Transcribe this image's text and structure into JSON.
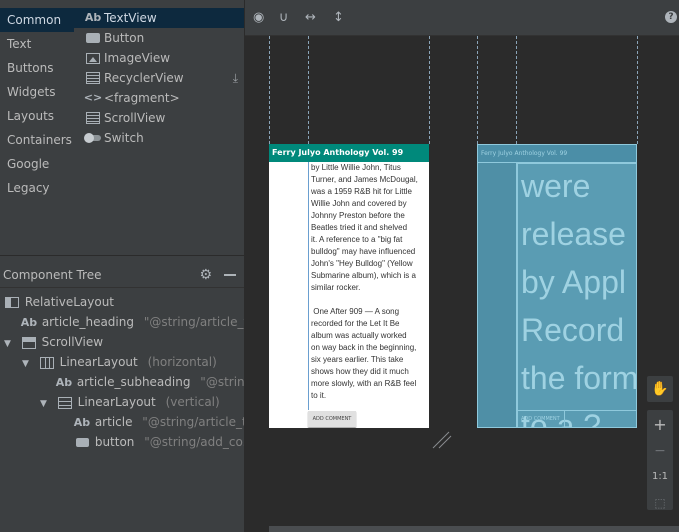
{
  "palette": {
    "categories": [
      "Common",
      "Text",
      "Buttons",
      "Widgets",
      "Layouts",
      "Containers",
      "Google",
      "Legacy"
    ],
    "selected_category": "Common",
    "items": [
      {
        "label": "TextView",
        "icon": "textview-icon",
        "glyph": "Ab"
      },
      {
        "label": "Button",
        "icon": "button-icon"
      },
      {
        "label": "ImageView",
        "icon": "imageview-icon"
      },
      {
        "label": "RecyclerView",
        "icon": "recyclerview-icon",
        "download": "⤓"
      },
      {
        "label": "<fragment>",
        "icon": "fragment-icon",
        "glyph": "<>"
      },
      {
        "label": "ScrollView",
        "icon": "scrollview-icon"
      },
      {
        "label": "Switch",
        "icon": "switch-icon"
      }
    ]
  },
  "tree": {
    "title": "Component Tree",
    "rows": [
      {
        "name": "RelativeLayout",
        "meta": "",
        "icon": "relativelayout-icon"
      },
      {
        "name": "article_heading",
        "meta": "\"@string/article_tit...",
        "icon": "textview-icon",
        "glyph": "Ab"
      },
      {
        "name": "ScrollView",
        "meta": "",
        "icon": "scrollview-icon",
        "arrow": "▼"
      },
      {
        "name": "LinearLayout",
        "meta": "(horizontal)",
        "icon": "linearlayout-horizontal-icon",
        "arrow": "▼"
      },
      {
        "name": "article_subheading",
        "meta": "\"@strin...",
        "icon": "textview-icon",
        "glyph": "Ab"
      },
      {
        "name": "LinearLayout",
        "meta": "(vertical)",
        "icon": "linearlayout-vertical-icon",
        "arrow": "▼"
      },
      {
        "name": "article",
        "meta": "\"@string/article_t...",
        "icon": "textview-icon",
        "glyph": "Ab"
      },
      {
        "name": "button",
        "meta": "\"@string/add_co...",
        "icon": "button-icon"
      }
    ]
  },
  "toolbar": {
    "eye": "◉",
    "magnet": "∪",
    "h_arrows": "↔",
    "v_arrows": "↕",
    "help": "?"
  },
  "device": {
    "heading": "Ferry Julyo Anthology Vol. 99",
    "article": "by Little Willie John, Titus\nTurner, and James McDougal,\nwas a 1959 R&B hit for Little\nWillie John and covered by\nJohnny Preston before the\nBeatles tried it and shelved\nit. A reference to a \"big fat\nbulldog\" may have influenced\nJohn's \"Hey Bulldog\" (Yellow\nSubmarine album), which is a\nsimilar rocker.\n\n One After 909 — A song\nrecorded for the Let It Be\nalbum was actually worked\non way back in the beginning,\nsix years earlier. This take\nshows how they did it much\nmore slowly, with an R&B feel\nto it.",
    "button": "ADD COMMENT"
  },
  "blueprint": {
    "heading": "Ferry Julyo Anthology Vol. 99",
    "text": "were\nrelease\nby Appl\nRecord\nthe form\nto a ?",
    "button": "ADD COMMENT"
  },
  "zoom": {
    "pan": "✋",
    "plus": "+",
    "minus": "−",
    "one_to_one": "1:1",
    "fit": "⬚"
  }
}
